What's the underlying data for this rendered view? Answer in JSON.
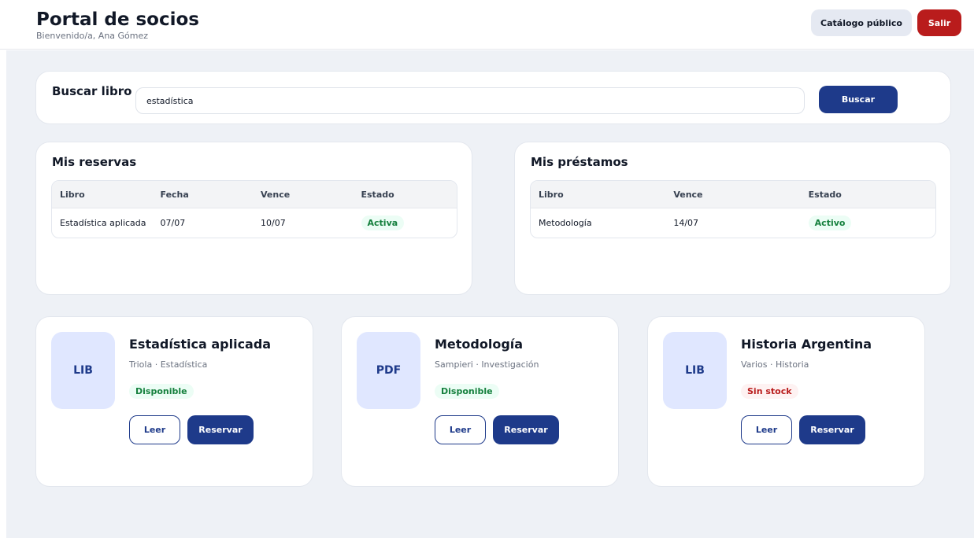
{
  "header": {
    "title": "Portal de socios",
    "welcome": "Bienvenido/a, Ana Gómez",
    "public_catalog_label": "Catálogo público",
    "exit_label": "Salir"
  },
  "search": {
    "title": "Buscar libro",
    "value": "estadística",
    "button_label": "Buscar"
  },
  "reservations": {
    "title": "Mis reservas",
    "columns": [
      "Libro",
      "Fecha",
      "Vence",
      "Estado"
    ],
    "rows": [
      {
        "libro": "Estadística aplicada",
        "fecha": "07/07",
        "vence": "10/07",
        "estado": "Activa"
      }
    ]
  },
  "loans": {
    "title": "Mis préstamos",
    "columns": [
      "Libro",
      "Vence",
      "Estado"
    ],
    "rows": [
      {
        "libro": "Metodología",
        "vence": "14/07",
        "estado": "Activo"
      }
    ]
  },
  "books": [
    {
      "cover": "LIB",
      "title": "Estadística aplicada",
      "meta": "Triola · Estadística",
      "status": "Disponible",
      "read_label": "Leer",
      "reserve_label": "Reservar"
    },
    {
      "cover": "PDF",
      "title": "Metodología",
      "meta": "Sampieri · Investigación",
      "status": "Disponible",
      "read_label": "Leer",
      "reserve_label": "Reservar"
    },
    {
      "cover": "LIB",
      "title": "Historia Argentina",
      "meta": "Varios · Historia",
      "status": "Sin stock",
      "read_label": "Leer",
      "reserve_label": "Reservar"
    }
  ],
  "colors": {
    "primary": "#1e3a8a",
    "danger": "#b91c1c",
    "success": "#15803d",
    "background": "#eef1f6"
  }
}
